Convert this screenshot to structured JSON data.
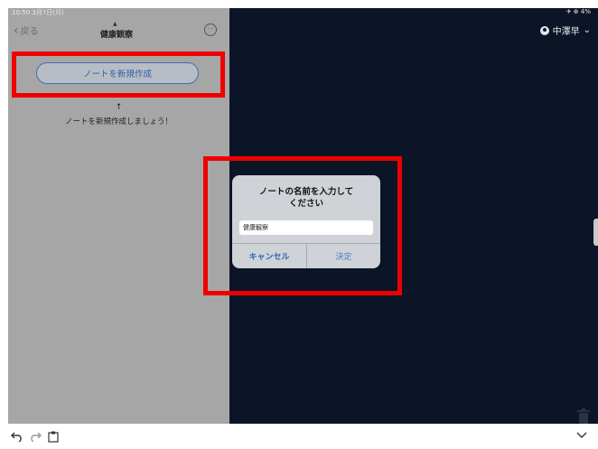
{
  "status_bar": {
    "time": "10:50 3月7日(月)",
    "indicators": "✈ ⊕ 4%"
  },
  "nav": {
    "back_label": "戻る",
    "title": "健康観察"
  },
  "left_pane": {
    "new_note_button": "ノートを新規作成",
    "arrow": "↑",
    "hint": "ノートを新規作成しましょう！"
  },
  "user": {
    "name": "中澤早"
  },
  "dialog": {
    "title_line1": "ノートの名前を入力して",
    "title_line2": "ください",
    "input_value": "健康観察",
    "cancel_label": "キャンセル",
    "ok_label": "決定"
  },
  "colors": {
    "highlight": "#ee0000",
    "accent": "#2f66b8",
    "dark_background": "#0c1527",
    "sidebar_background": "#a6a6a6"
  }
}
